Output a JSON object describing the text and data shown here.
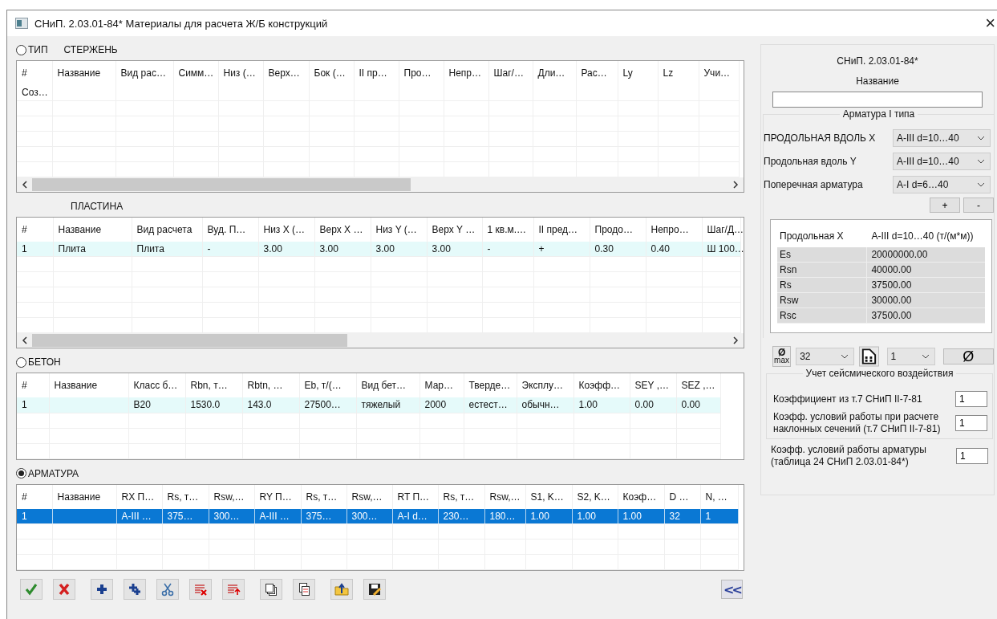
{
  "window": {
    "title": "СНиП. 2.03.01-84*  Материалы для расчета Ж/Б конструкций",
    "close": "×"
  },
  "sections": [
    {
      "radio": {
        "label": "ТИП",
        "checked": false
      },
      "label": "СТЕРЖЕНЬ",
      "scrollbar": true,
      "columns": [
        "#",
        "Название",
        "Вид рас…",
        "Симм…",
        "Низ (…",
        "Верх…",
        "Бок (…",
        "II пр…",
        "Про…",
        "Непр…",
        "Шаг/…",
        "Дли…",
        "Рас…",
        "Ly",
        "Lz",
        "Учи…"
      ],
      "header_overflow": "Соз…"
    },
    {
      "label": "ПЛАСТИНА",
      "scrollbar": true,
      "columns": [
        "#",
        "Название",
        "Вид расчета",
        "Вуд. П…",
        "Низ X (…",
        "Верх X …",
        "Низ Y (…",
        "Верх Y …",
        "1 кв.м.…",
        "II пред…",
        "Продо…",
        "Непро…",
        "Шаг/Д…"
      ],
      "rows": [
        {
          "selected": false,
          "cells": [
            "1",
            "Плита",
            "Плита",
            "-",
            "3.00",
            "3.00",
            "3.00",
            "3.00",
            "-",
            "+",
            "0.30",
            "0.40",
            "Ш 100…"
          ]
        }
      ]
    },
    {
      "radio": {
        "label": "БЕТОН",
        "checked": false
      },
      "scrollbar": false,
      "columns": [
        "#",
        "Название",
        "Класс б…",
        "Rbn, т…",
        "Rbtn, …",
        "Eb, т/(…",
        "Вид бет…",
        "Мар…",
        "Тверде…",
        "Эксплу…",
        "Коэфф…",
        "SEY ,…",
        "SEZ ,…"
      ],
      "rows": [
        {
          "selected": false,
          "cells": [
            "1",
            "",
            "B20",
            "1530.0",
            "143.0",
            "27500…",
            "тяжелый",
            "2000",
            "естест…",
            "обычн…",
            "1.00",
            "0.00",
            "0.00"
          ]
        }
      ]
    },
    {
      "radio": {
        "label": "АРМАТУРА",
        "checked": true
      },
      "scrollbar": false,
      "columns": [
        "#",
        "Название",
        "RX П…",
        "Rs, т…",
        "Rsw,…",
        "RY П…",
        "Rs, т…",
        "Rsw,…",
        "RT П…",
        "Rs, т…",
        "Rsw,…",
        "S1, K…",
        "S2, K…",
        "Коэф…",
        "D …",
        "N, …"
      ],
      "rows": [
        {
          "selected": true,
          "cells": [
            "1",
            "",
            "A-III …",
            "375…",
            "300…",
            "A-III …",
            "375…",
            "300…",
            "A-I d…",
            "230…",
            "180…",
            "1.00",
            "1.00",
            "1.00",
            "32",
            "1"
          ]
        }
      ]
    }
  ],
  "collapse_button": "<<",
  "panel": {
    "standard": "СНиП. 2.03.01-84*",
    "name_label": "Название",
    "rebar_group": {
      "title": "Арматура I типа",
      "rows": [
        {
          "label": "ПРОДОЛЬНАЯ ВДОЛЬ X",
          "value": "A-III d=10…40"
        },
        {
          "label": "Продольная вдоль Y",
          "value": "A-III d=10…40"
        },
        {
          "label": "Поперечная арматура",
          "value": "A-I d=6…40"
        }
      ],
      "buttons": [
        "+",
        "-"
      ]
    },
    "property_table": {
      "columns": [
        "Продольная  X",
        "A-III d=10…40 (т/(м*м))"
      ],
      "rows": [
        [
          "Es",
          "20000000.00"
        ],
        [
          "Rsn",
          "40000.00"
        ],
        [
          "Rs",
          "37500.00"
        ],
        [
          "Rsw",
          "30000.00"
        ],
        [
          "Rsc",
          "37500.00"
        ]
      ]
    },
    "diameter_row": {
      "max_symbol": "Ø",
      "max_sub": "max",
      "max_diameter": "32",
      "count": "1",
      "symbol_button": "Ø"
    },
    "seismic": {
      "title": "Учет сейсмического  воздействия",
      "rows": [
        {
          "label": "Коэффициент из т.7 СНиП II-7-81",
          "value": "1"
        },
        {
          "label": "Коэфф. условий работы при расчете наклонных сечений (т.7 СНиП II-7-81)",
          "value": "1"
        }
      ]
    },
    "rebar_factor": {
      "label": "Коэфф. условий работы арматуры (таблица 24 СНиП 2.03.01-84*)",
      "value": "1"
    }
  }
}
